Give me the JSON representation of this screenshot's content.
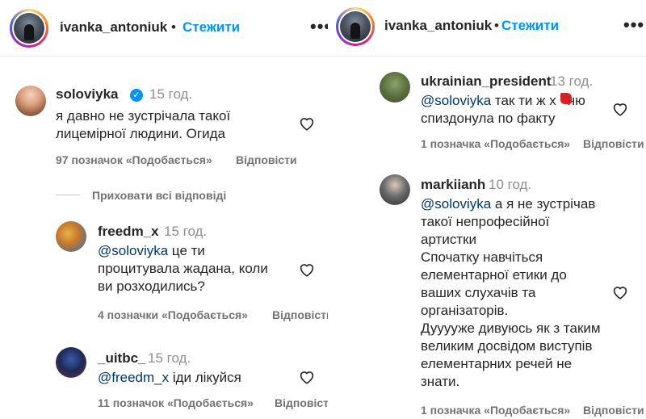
{
  "left_panel": {
    "header": {
      "username": "ivanka_antoniuk",
      "separator": "•",
      "follow_label": "Стежити",
      "more_label": "•••"
    },
    "main_comment": {
      "username": "soloviyka",
      "verified": true,
      "time": "15 год.",
      "text": "я давно не зустрічала такої\nлицемірної людини. Огида",
      "likes": "97 позначок «Подобається»",
      "reply_label": "Відповісти"
    },
    "hide_replies_label": "Приховати всі відповіді",
    "replies": [
      {
        "username": "freedm_x",
        "time": "15 год.",
        "mention": "@soloviyka",
        "text_after_mention": " це ти\nпроцитувала жадана, коли\nви розходились?",
        "likes": "4 позначки «Подобається»",
        "reply_label": "Відповісти"
      },
      {
        "username": "_uitbc_",
        "time": "15 год.",
        "mention": "@freedm_x",
        "text_after_mention": " іди лікуйся",
        "likes": "11 позначок «Подобається»",
        "reply_label": "Відповісти"
      }
    ]
  },
  "right_panel": {
    "header": {
      "username": "ivanka_antoniuk",
      "separator": "•",
      "follow_label": "Стежити",
      "more_label": "•••"
    },
    "comments": [
      {
        "username": "ukrainian_president",
        "time": "13 год.",
        "mention": "@soloviyka",
        "text_line1_after_mention": " так ти ж х",
        "text_line1_tail": "ню",
        "text_line2": "спиздонула по факту",
        "likes": "1 позначка «Подобається»",
        "reply_label": "Відповісти"
      },
      {
        "username": "markiianh",
        "time": "10 год.",
        "mention": "@soloviyka",
        "text_after_mention": " а я не зустрічав\nтакої непрофесійної\nартистки\nСпочатку навчіться\nелементарної етики до\nваших слухачів та\nорганізаторів.\nДууууже дивуюсь як з таким\nвеликим досвідом виступів\nелементарних речей не\nзнати.",
        "likes": "1 позначка «Подобається»",
        "reply_label": "Відповісти"
      }
    ]
  },
  "colors": {
    "accent": "#0095f6",
    "mention": "#00376b",
    "muted": "#737373",
    "redaction": "#d81f26"
  }
}
